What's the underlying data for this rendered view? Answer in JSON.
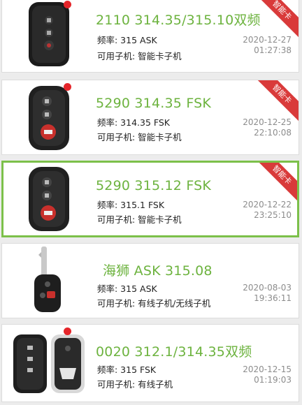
{
  "items": [
    {
      "title": "2110 314.35/315.10双频",
      "freq": "频率: 315 ASK",
      "compat": "可用子机: 智能卡子机",
      "date": "2020-12-27",
      "time": "01:27:38",
      "badge": "智能卡",
      "has_dot": true,
      "key_type": "smart-key-toyota-3btn"
    },
    {
      "title": "5290 314.35 FSK",
      "freq": "频率: 314.35 FSK",
      "compat": "可用子机: 智能卡子机",
      "date": "2020-12-25",
      "time": "22:10:08",
      "badge": "智能卡",
      "has_dot": true,
      "key_type": "smart-key-toyota-3btn-red"
    },
    {
      "title": "5290 315.12 FSK",
      "freq": "频率: 315.1 FSK",
      "compat": "可用子机: 智能卡子机",
      "date": "2020-12-22",
      "time": "23:25:10",
      "badge": "智能卡",
      "has_dot": false,
      "selected": true,
      "key_type": "smart-key-toyota-3btn-red"
    },
    {
      "title": "海狮 ASK 315.08",
      "freq": "频率: 315 ASK",
      "compat": "可用子机: 有线子机/无线子机",
      "date": "2020-08-03",
      "time": "19:36:11",
      "badge": "",
      "has_dot": false,
      "key_type": "blade-key-toyota"
    },
    {
      "title": "0020 312.1/314.35双频",
      "freq": "频率: 315 FSK",
      "compat": "可用子机: 有线子机",
      "date": "2020-12-15",
      "time": "01:19:03",
      "badge": "",
      "has_dot": true,
      "key_type": "smart-key-lexus-pair"
    }
  ],
  "colors": {
    "title_green": "#6db33f",
    "badge_red": "#d93a3a",
    "selected_border": "#7cc04a"
  }
}
